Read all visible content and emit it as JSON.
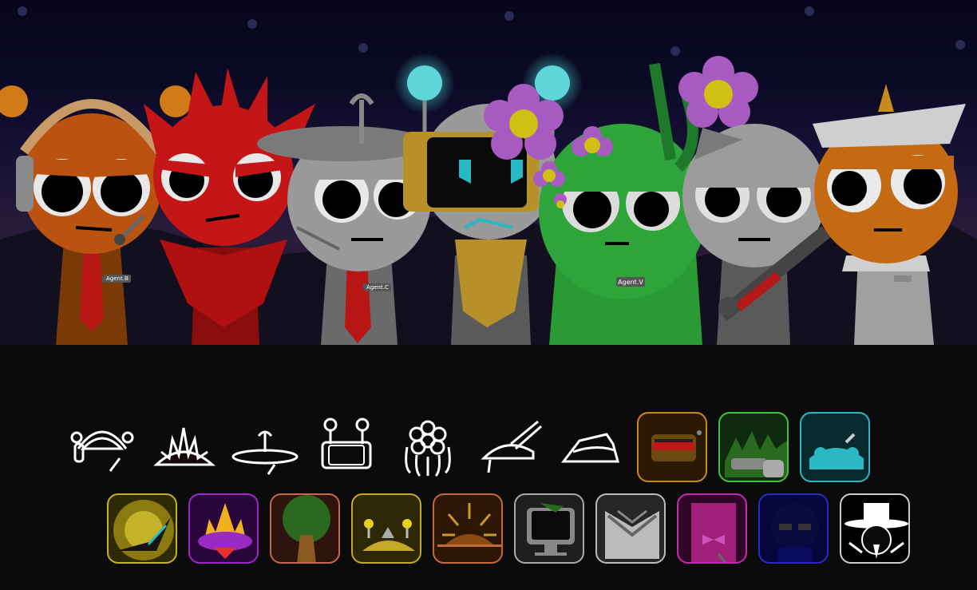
{
  "stage": {
    "characters": [
      {
        "id": "brud",
        "color": "#b9530f"
      },
      {
        "id": "raddy",
        "color": "#c41616"
      },
      {
        "id": "clukr",
        "color": "#9a9a9a"
      },
      {
        "id": "fun-bot",
        "color": "#9a9a9a"
      },
      {
        "id": "vineria",
        "color": "#2ea43a"
      },
      {
        "id": "gray",
        "color": "#9c9c9c"
      },
      {
        "id": "oren",
        "color": "#c46a12"
      }
    ],
    "name_tags": [
      "Agent.B",
      "Agent.C",
      "Agent.V"
    ]
  },
  "palette": {
    "row1": [
      {
        "id": "headphones-icon",
        "style": "outline"
      },
      {
        "id": "spiky-crown-icon",
        "style": "outline"
      },
      {
        "id": "antenna-hat-icon",
        "style": "outline"
      },
      {
        "id": "robot-screen-icon",
        "style": "outline"
      },
      {
        "id": "flower-mane-icon",
        "style": "outline"
      },
      {
        "id": "shotgun-hat-icon",
        "style": "outline"
      },
      {
        "id": "captain-hat-icon",
        "style": "outline"
      },
      {
        "id": "visor-icon",
        "style": "card",
        "border": "#c78a1c",
        "bg": "#2a1a04"
      },
      {
        "id": "minigun-icon",
        "style": "card",
        "border": "#44c43a",
        "bg": "#0f2a0f"
      },
      {
        "id": "teal-bot-icon",
        "style": "card",
        "border": "#2ab8c4",
        "bg": "#062a2e"
      }
    ],
    "row2": [
      {
        "id": "yellow-stealth-icon",
        "style": "card",
        "border": "#c4b22a",
        "bg": "#2e2a06"
      },
      {
        "id": "purple-flame-icon",
        "style": "card",
        "border": "#9a2ac4",
        "bg": "#2a063a"
      },
      {
        "id": "tree-icon",
        "style": "card",
        "border": "#c46a4a",
        "bg": "#2e140c"
      },
      {
        "id": "yellow-antenna-icon",
        "style": "card",
        "border": "#c4a82a",
        "bg": "#2e2806"
      },
      {
        "id": "sun-crown-icon",
        "style": "card",
        "border": "#c46a3a",
        "bg": "#2e1606"
      },
      {
        "id": "monitor-icon",
        "style": "card",
        "border": "#aaaaaa",
        "bg": "#1e1e1e"
      },
      {
        "id": "gray-chevron-icon",
        "style": "card",
        "border": "#bbbbbb",
        "bg": "#262626"
      },
      {
        "id": "pink-bow-icon",
        "style": "card",
        "border": "#c42ab0",
        "bg": "#2e0628"
      },
      {
        "id": "blue-shades-icon",
        "style": "card",
        "border": "#2a2ac4",
        "bg": "#06063a"
      },
      {
        "id": "top-hat-icon",
        "style": "card",
        "border": "#cccccc",
        "bg": "#000000"
      }
    ]
  }
}
